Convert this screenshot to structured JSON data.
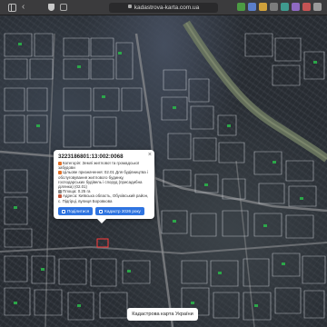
{
  "browser": {
    "url": "kadastrova-karta.com.ua"
  },
  "popup": {
    "cadastral_number": "3223186801:13:002:0068",
    "lines": [
      "Категорія: Землі житлової та громадської забудови",
      "Цільове призначення: 02.01 Для будівництва і обслуговування житлового будинку, господарських будівель і споруд (присадибна ділянка) (02.01)",
      "Площа: 0.25 га",
      "Адреса: Київська область, Обухівський район, с. Підгірці, вулиця Боровкова"
    ],
    "share_label": "Поділитися",
    "cadastre_label": "Кадастр 2026 року"
  },
  "footer": {
    "map_title": "Кадастрова карта України"
  },
  "colors": {
    "accent": "#2f74e0",
    "parcel_outline": "#dfe3ea",
    "parcel_green": "#2bb34a",
    "river": "#6f7a62"
  }
}
